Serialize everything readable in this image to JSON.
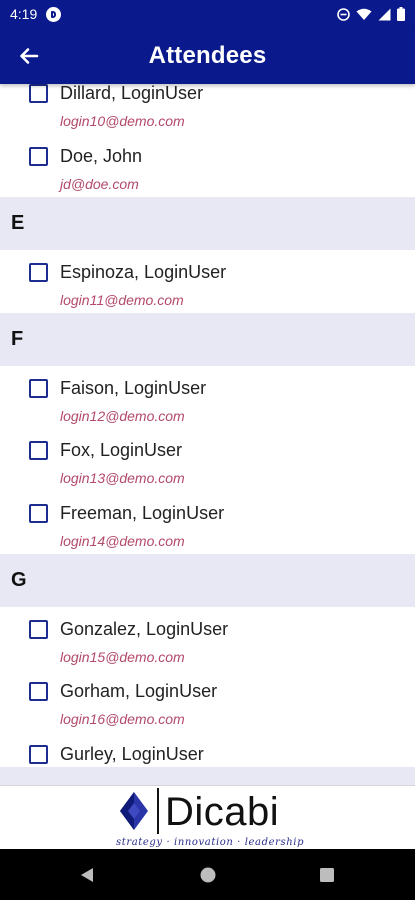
{
  "status_bar": {
    "time": "4:19"
  },
  "app_bar": {
    "title": "Attendees"
  },
  "sections": [
    "E",
    "F",
    "G"
  ],
  "attendees": [
    {
      "name": "Dillard, LoginUser",
      "email": "login10@demo.com"
    },
    {
      "name": "Doe, John",
      "email": "jd@doe.com"
    },
    {
      "name": "Espinoza, LoginUser",
      "email": "login11@demo.com"
    },
    {
      "name": "Faison, LoginUser",
      "email": "login12@demo.com"
    },
    {
      "name": "Fox, LoginUser",
      "email": "login13@demo.com"
    },
    {
      "name": "Freeman, LoginUser",
      "email": "login14@demo.com"
    },
    {
      "name": "Gonzalez, LoginUser",
      "email": "login15@demo.com"
    },
    {
      "name": "Gorham, LoginUser",
      "email": "login16@demo.com"
    },
    {
      "name": "Gurley, LoginUser",
      "email": ""
    }
  ],
  "footer": {
    "logo_text": "Dicabi",
    "tagline": "strategy · innovation · leadership"
  },
  "colors": {
    "primary": "#0a1a8c",
    "section_bg": "#e8e8f4",
    "email": "#b34a6a",
    "checkbox": "#1c2d8f"
  },
  "icons": [
    "back-arrow-icon",
    "do-not-disturb-icon",
    "wifi-icon",
    "signal-icon",
    "battery-icon",
    "nav-back-icon",
    "nav-home-icon",
    "nav-recents-icon"
  ]
}
